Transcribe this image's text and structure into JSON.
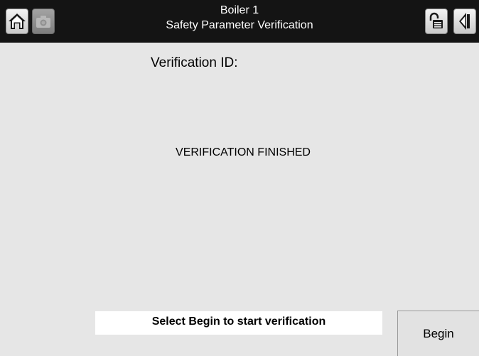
{
  "header": {
    "title_line1": "Boiler 1",
    "title_line2": "Safety Parameter Verification",
    "left_buttons": [
      {
        "icon": "home-icon",
        "enabled": true
      },
      {
        "icon": "camera-icon",
        "enabled": false
      }
    ],
    "right_buttons": [
      {
        "icon": "lock-icon",
        "enabled": true
      },
      {
        "icon": "back-icon",
        "enabled": true
      }
    ],
    "background_color": "#141414"
  },
  "main": {
    "verification_id_label": "Verification ID:",
    "status_message": "VERIFICATION FINISHED",
    "background_color": "#e6e6e6"
  },
  "footer": {
    "prompt_text": "Select Begin to start verification",
    "begin_label": "Begin"
  }
}
